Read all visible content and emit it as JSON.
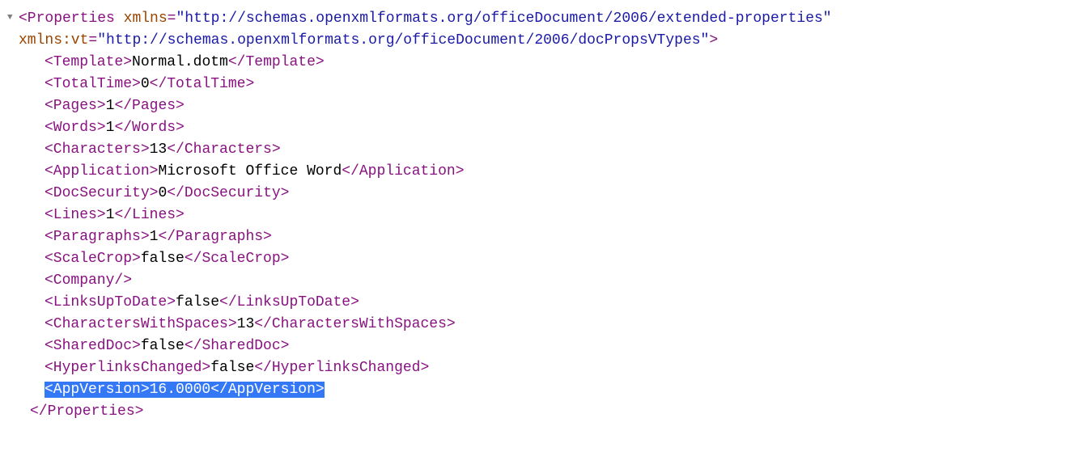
{
  "root": {
    "open_tag": "<Properties",
    "attrs": [
      {
        "name": "xmlns",
        "value": "\"http://schemas.openxmlformats.org/officeDocument/2006/extended-properties\""
      },
      {
        "name": "xmlns:vt",
        "value": "\"http://schemas.openxmlformats.org/officeDocument/2006/docPropsVTypes\""
      }
    ],
    "tag_close": ">",
    "close_tag": "</Properties>"
  },
  "children": [
    {
      "open": "<Template>",
      "text": "Normal.dotm",
      "close": "</Template>",
      "highlighted": false
    },
    {
      "open": "<TotalTime>",
      "text": "0",
      "close": "</TotalTime>",
      "highlighted": false
    },
    {
      "open": "<Pages>",
      "text": "1",
      "close": "</Pages>",
      "highlighted": false
    },
    {
      "open": "<Words>",
      "text": "1",
      "close": "</Words>",
      "highlighted": false
    },
    {
      "open": "<Characters>",
      "text": "13",
      "close": "</Characters>",
      "highlighted": false
    },
    {
      "open": "<Application>",
      "text": "Microsoft Office Word",
      "close": "</Application>",
      "highlighted": false
    },
    {
      "open": "<DocSecurity>",
      "text": "0",
      "close": "</DocSecurity>",
      "highlighted": false
    },
    {
      "open": "<Lines>",
      "text": "1",
      "close": "</Lines>",
      "highlighted": false
    },
    {
      "open": "<Paragraphs>",
      "text": "1",
      "close": "</Paragraphs>",
      "highlighted": false
    },
    {
      "open": "<ScaleCrop>",
      "text": "false",
      "close": "</ScaleCrop>",
      "highlighted": false
    },
    {
      "open": "<Company/>",
      "text": "",
      "close": "",
      "highlighted": false
    },
    {
      "open": "<LinksUpToDate>",
      "text": "false",
      "close": "</LinksUpToDate>",
      "highlighted": false
    },
    {
      "open": "<CharactersWithSpaces>",
      "text": "13",
      "close": "</CharactersWithSpaces>",
      "highlighted": false
    },
    {
      "open": "<SharedDoc>",
      "text": "false",
      "close": "</SharedDoc>",
      "highlighted": false
    },
    {
      "open": "<HyperlinksChanged>",
      "text": "false",
      "close": "</HyperlinksChanged>",
      "highlighted": false
    },
    {
      "open": "<AppVersion>",
      "text": "16.0000",
      "close": "</AppVersion>",
      "highlighted": true
    }
  ],
  "disclosure": "▼"
}
